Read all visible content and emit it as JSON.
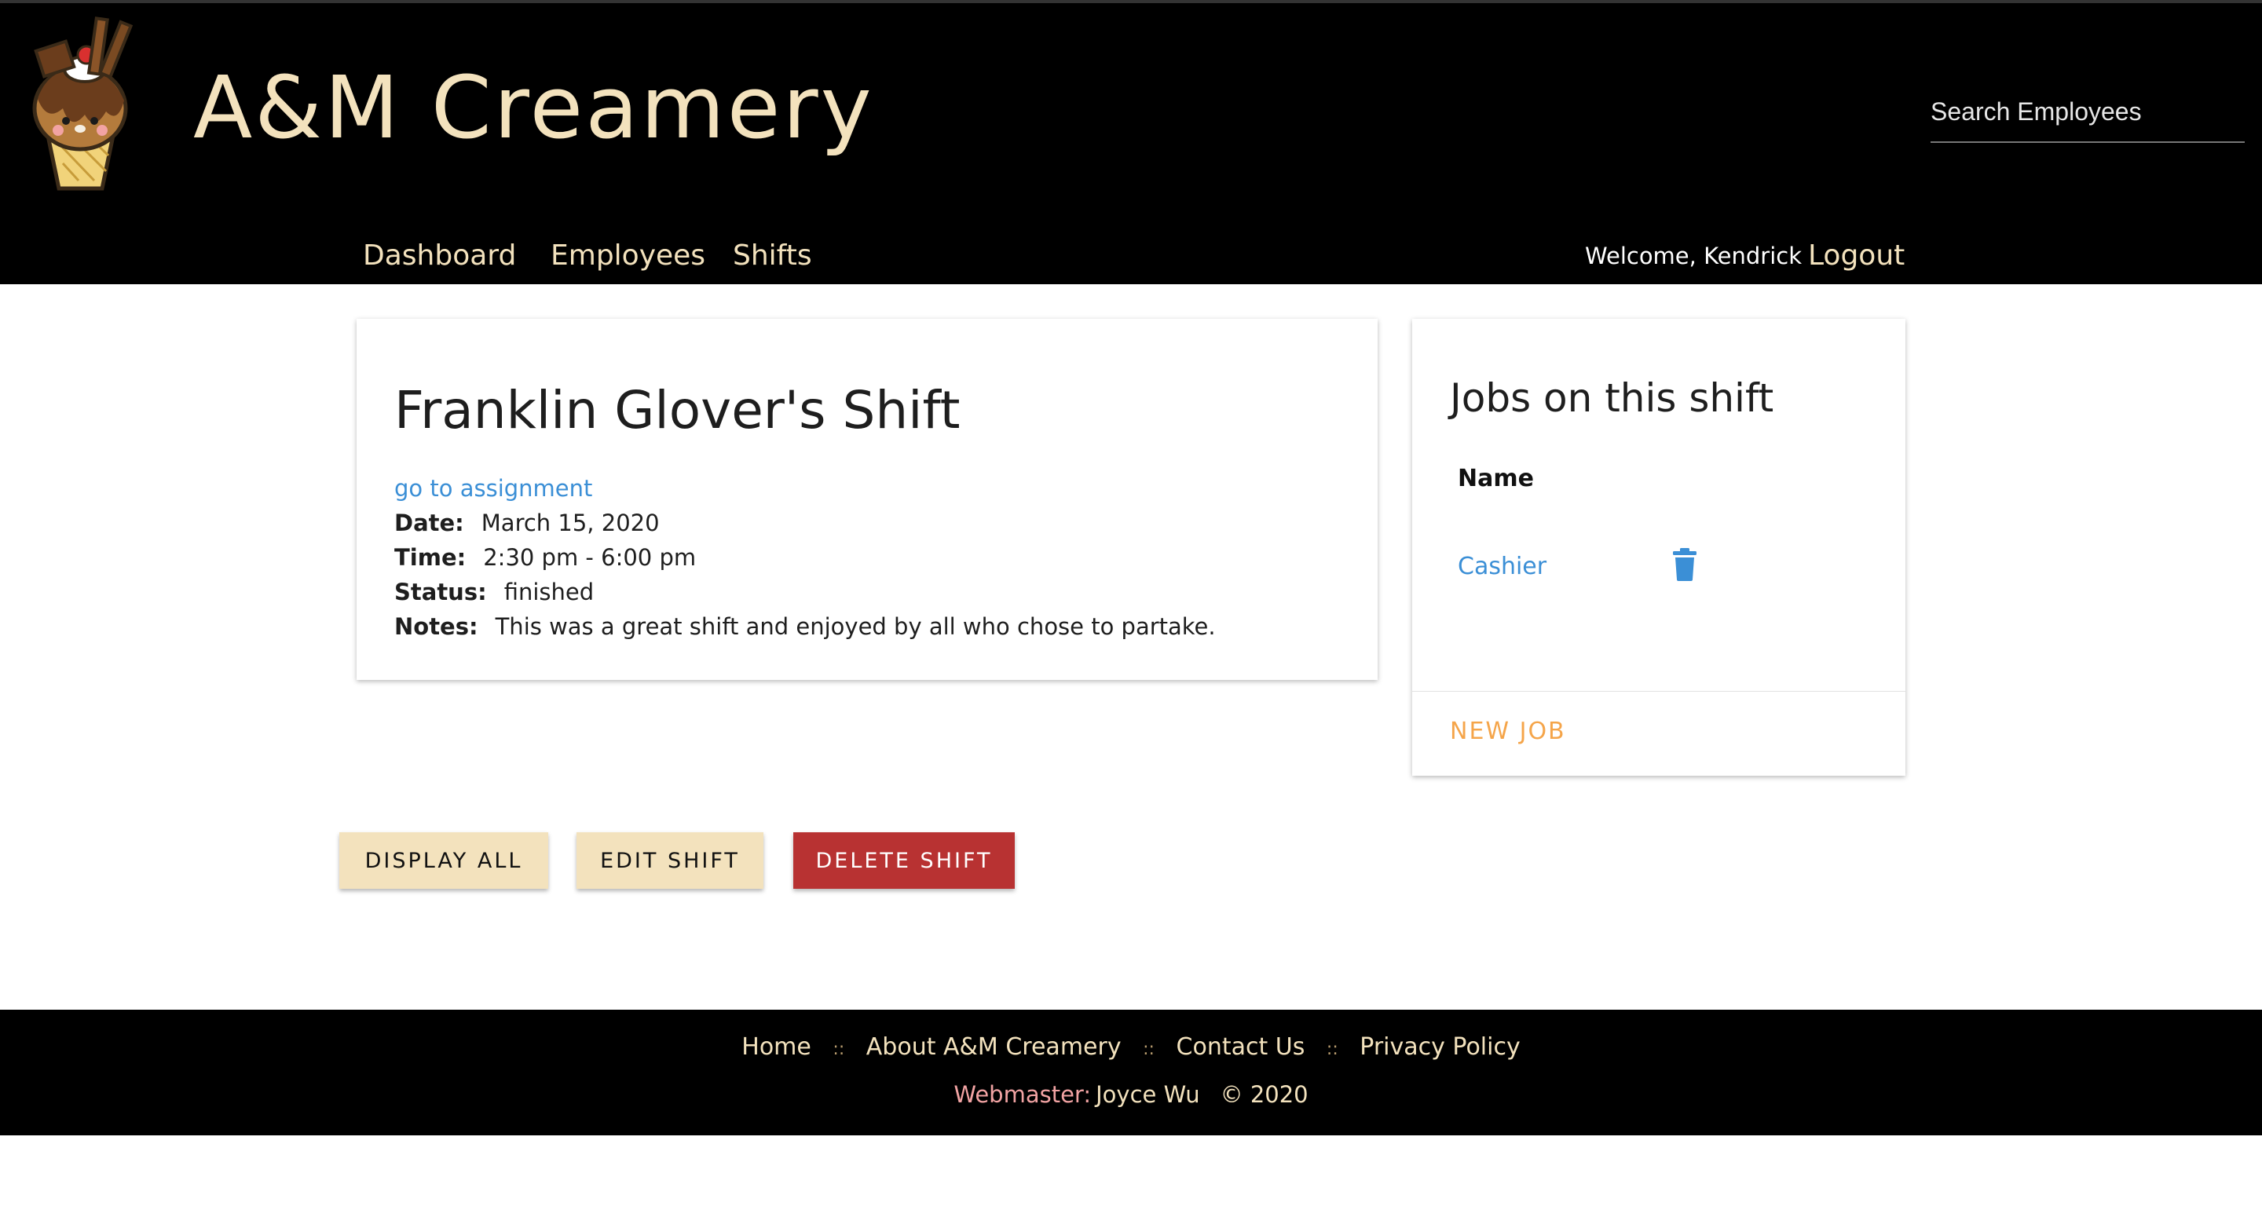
{
  "header": {
    "brand": "A&M Creamery",
    "search_placeholder": "Search Employees",
    "nav": [
      "Dashboard",
      "Employees",
      "Shifts"
    ],
    "welcome": "Welcome, Kendrick",
    "logout": "Logout"
  },
  "shift": {
    "title": "Franklin Glover's Shift",
    "assignment_link": "go to assignment",
    "date_label": "Date:",
    "date": "March 15, 2020",
    "time_label": "Time:",
    "time": "2:30 pm - 6:00 pm",
    "status_label": "Status:",
    "status": "finished",
    "notes_label": "Notes:",
    "notes": "This was a great shift and enjoyed by all who chose to partake."
  },
  "jobs": {
    "title": "Jobs on this shift",
    "column": "Name",
    "items": [
      "Cashier"
    ],
    "new_job": "NEW JOB"
  },
  "buttons": {
    "display_all": "DISPLAY ALL",
    "edit_shift": "EDIT SHIFT",
    "delete_shift": "DELETE SHIFT"
  },
  "footer": {
    "links": [
      "Home",
      "About A&M Creamery",
      "Contact Us",
      "Privacy Policy"
    ],
    "separator": "::",
    "webmaster_label": "Webmaster:",
    "webmaster_name": "Joyce Wu",
    "copyright": "© 2020"
  },
  "colors": {
    "cream": "#f3e2bd",
    "link_blue": "#3b8fd6",
    "delete_red": "#b83232",
    "new_job_orange": "#f5a54a",
    "webmaster_pink": "#f2a3a3"
  },
  "icons": [
    "ice-cream-logo",
    "trash-icon"
  ]
}
